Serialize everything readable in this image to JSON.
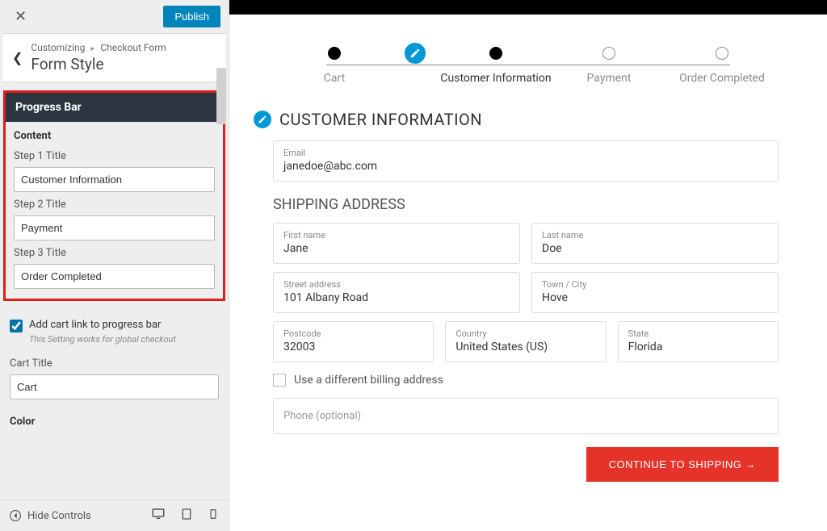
{
  "sidebar": {
    "publish_label": "Publish",
    "breadcrumb_root": "Customizing",
    "breadcrumb_leaf": "Checkout Form",
    "panel_title": "Form Style",
    "progress_bar": {
      "section_label": "Progress Bar",
      "content_label": "Content",
      "step1_label": "Step 1 Title",
      "step1_value": "Customer Information",
      "step2_label": "Step 2 Title",
      "step2_value": "Payment",
      "step3_label": "Step 3 Title",
      "step3_value": "Order Completed"
    },
    "add_cart_checkbox_label": "Add cart link to progress bar",
    "add_cart_checkbox_help": "This Setting works for global checkout",
    "cart_title_label": "Cart Title",
    "cart_title_value": "Cart",
    "color_label": "Color",
    "hide_controls_label": "Hide Controls"
  },
  "preview": {
    "steps": {
      "cart": "Cart",
      "customer_info": "Customer Information",
      "payment": "Payment",
      "order_completed": "Order Completed"
    },
    "section_customer_info": "CUSTOMER INFORMATION",
    "email_label": "Email",
    "email_value": "janedoe@abc.com",
    "shipping_heading": "SHIPPING ADDRESS",
    "first_name_label": "First name",
    "first_name_value": "Jane",
    "last_name_label": "Last name",
    "last_name_value": "Doe",
    "street_label": "Street address",
    "street_value": "101 Albany Road",
    "town_label": "Town / City",
    "town_value": "Hove",
    "postcode_label": "Postcode",
    "postcode_value": "32003",
    "country_label": "Country",
    "country_value": "United States (US)",
    "state_label": "State",
    "state_value": "Florida",
    "diff_billing_label": "Use a different billing address",
    "phone_placeholder": "Phone (optional)",
    "continue_label": "CONTINUE TO SHIPPING →"
  }
}
